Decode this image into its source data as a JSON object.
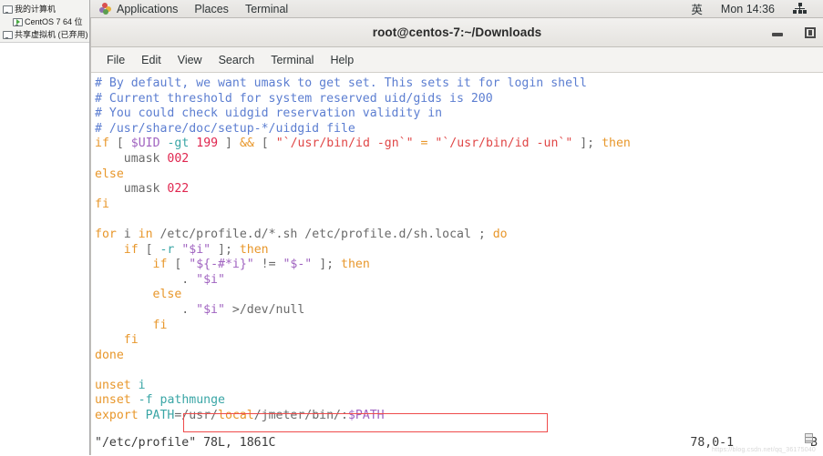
{
  "vm_sidebar": {
    "items": [
      {
        "label": "我的计算机",
        "icon": "computer-icon",
        "indent": false
      },
      {
        "label": "CentOS 7 64 位",
        "icon": "vm-running-icon",
        "indent": true
      },
      {
        "label": "共享虚拟机 (已弃用)",
        "icon": "shared-vm-icon",
        "indent": false
      }
    ]
  },
  "panel": {
    "apps_label": "Applications",
    "places_label": "Places",
    "terminal_label": "Terminal",
    "input_method": "英",
    "clock": "Mon 14:36",
    "network_icon": "network-workgroup-icon"
  },
  "window": {
    "title": "root@centos-7:~/Downloads",
    "minimize_label": "minimize",
    "maximize_label": "maximize"
  },
  "menubar": {
    "items": [
      "File",
      "Edit",
      "View",
      "Search",
      "Terminal",
      "Help"
    ]
  },
  "terminal": {
    "lines": [
      [
        {
          "t": "# By default, we want umask to get set. This sets it for login shell",
          "c": "c-cm"
        }
      ],
      [
        {
          "t": "# Current threshold for system reserved uid/gids is 200",
          "c": "c-cm"
        }
      ],
      [
        {
          "t": "# You could check uidgid reservation validity in",
          "c": "c-cm"
        }
      ],
      [
        {
          "t": "# /usr/share/doc/setup-*/uidgid file",
          "c": "c-cm"
        }
      ],
      [
        {
          "t": "if",
          "c": "c-kw"
        },
        {
          "t": " ",
          "c": "c-pl"
        },
        {
          "t": "[",
          "c": "c-pl"
        },
        {
          "t": " ",
          "c": "c-pl"
        },
        {
          "t": "$UID",
          "c": "c-var"
        },
        {
          "t": " ",
          "c": "c-pl"
        },
        {
          "t": "-gt",
          "c": "c-tl"
        },
        {
          "t": " ",
          "c": "c-pl"
        },
        {
          "t": "199",
          "c": "c-num"
        },
        {
          "t": " ",
          "c": "c-pl"
        },
        {
          "t": "]",
          "c": "c-pl"
        },
        {
          "t": " ",
          "c": "c-pl"
        },
        {
          "t": "&&",
          "c": "c-op"
        },
        {
          "t": " ",
          "c": "c-pl"
        },
        {
          "t": "[",
          "c": "c-pl"
        },
        {
          "t": " ",
          "c": "c-pl"
        },
        {
          "t": "\"`/usr/bin/id -gn`\"",
          "c": "c-str"
        },
        {
          "t": " ",
          "c": "c-pl"
        },
        {
          "t": "=",
          "c": "c-op"
        },
        {
          "t": " ",
          "c": "c-pl"
        },
        {
          "t": "\"`/usr/bin/id -un`\"",
          "c": "c-str"
        },
        {
          "t": " ",
          "c": "c-pl"
        },
        {
          "t": "]",
          "c": "c-pl"
        },
        {
          "t": "; ",
          "c": "c-pl"
        },
        {
          "t": "then",
          "c": "c-kw"
        }
      ],
      [
        {
          "t": "    umask ",
          "c": "c-pl"
        },
        {
          "t": "002",
          "c": "c-num"
        }
      ],
      [
        {
          "t": "else",
          "c": "c-kw"
        }
      ],
      [
        {
          "t": "    umask ",
          "c": "c-pl"
        },
        {
          "t": "022",
          "c": "c-num"
        }
      ],
      [
        {
          "t": "fi",
          "c": "c-kw"
        }
      ],
      [
        {
          "t": "",
          "c": "c-pl"
        }
      ],
      [
        {
          "t": "for",
          "c": "c-kw"
        },
        {
          "t": " i ",
          "c": "c-pl"
        },
        {
          "t": "in",
          "c": "c-kw"
        },
        {
          "t": " /etc/profile.d/*.sh /etc/profile.d/sh.local ; ",
          "c": "c-pl"
        },
        {
          "t": "do",
          "c": "c-kw"
        }
      ],
      [
        {
          "t": "    ",
          "c": "c-pl"
        },
        {
          "t": "if",
          "c": "c-kw"
        },
        {
          "t": " [ ",
          "c": "c-pl"
        },
        {
          "t": "-r",
          "c": "c-tl"
        },
        {
          "t": " ",
          "c": "c-pl"
        },
        {
          "t": "\"$i\"",
          "c": "c-var"
        },
        {
          "t": " ]; ",
          "c": "c-pl"
        },
        {
          "t": "then",
          "c": "c-kw"
        }
      ],
      [
        {
          "t": "        ",
          "c": "c-pl"
        },
        {
          "t": "if",
          "c": "c-kw"
        },
        {
          "t": " [ ",
          "c": "c-pl"
        },
        {
          "t": "\"${-#*i}\"",
          "c": "c-var"
        },
        {
          "t": " != ",
          "c": "c-pl"
        },
        {
          "t": "\"$-\"",
          "c": "c-var"
        },
        {
          "t": " ]; ",
          "c": "c-pl"
        },
        {
          "t": "then",
          "c": "c-kw"
        }
      ],
      [
        {
          "t": "            . ",
          "c": "c-pl"
        },
        {
          "t": "\"$i\"",
          "c": "c-var"
        }
      ],
      [
        {
          "t": "        ",
          "c": "c-pl"
        },
        {
          "t": "else",
          "c": "c-kw"
        }
      ],
      [
        {
          "t": "            . ",
          "c": "c-pl"
        },
        {
          "t": "\"$i\"",
          "c": "c-var"
        },
        {
          "t": " ",
          "c": "c-pl"
        },
        {
          "t": ">",
          "c": "c-pl"
        },
        {
          "t": "/dev/null",
          "c": "c-pl"
        }
      ],
      [
        {
          "t": "        ",
          "c": "c-pl"
        },
        {
          "t": "fi",
          "c": "c-kw"
        }
      ],
      [
        {
          "t": "    ",
          "c": "c-pl"
        },
        {
          "t": "fi",
          "c": "c-kw"
        }
      ],
      [
        {
          "t": "done",
          "c": "c-kw"
        }
      ],
      [
        {
          "t": "",
          "c": "c-pl"
        }
      ],
      [
        {
          "t": "unset",
          "c": "c-kw"
        },
        {
          "t": " ",
          "c": "c-pl"
        },
        {
          "t": "i",
          "c": "c-tl"
        }
      ],
      [
        {
          "t": "unset",
          "c": "c-kw"
        },
        {
          "t": " ",
          "c": "c-pl"
        },
        {
          "t": "-f",
          "c": "c-tl"
        },
        {
          "t": " ",
          "c": "c-pl"
        },
        {
          "t": "pathmunge",
          "c": "c-tl"
        }
      ],
      [
        {
          "t": "export",
          "c": "c-kw"
        },
        {
          "t": " ",
          "c": "c-pl"
        },
        {
          "t": "PATH",
          "c": "c-tl"
        },
        {
          "t": "=/usr/",
          "c": "c-pl"
        },
        {
          "t": "local",
          "c": "c-kw"
        },
        {
          "t": "/jmeter/bin/:",
          "c": "c-pl"
        },
        {
          "t": "$PATH",
          "c": "c-var"
        }
      ]
    ],
    "highlight_color": "#ef4b4b"
  },
  "status": {
    "file": "\"/etc/profile\" 78L, 1861C",
    "position": "78,0-1",
    "scroll": "B",
    "watermark": "https://blog.csdn.net/qq_36175040"
  }
}
